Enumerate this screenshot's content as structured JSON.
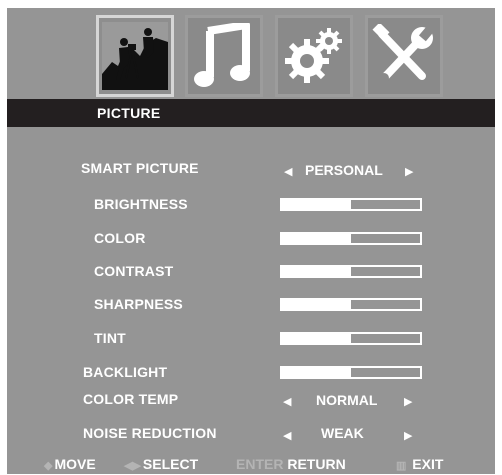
{
  "menu": {
    "tabs": [
      {
        "name": "picture",
        "icon": "photographer-icon",
        "active": true
      },
      {
        "name": "audio",
        "icon": "music-note-icon",
        "active": false
      },
      {
        "name": "settings",
        "icon": "gears-icon",
        "active": false
      },
      {
        "name": "tools",
        "icon": "wrench-screwdriver-icon",
        "active": false
      }
    ],
    "title": "PICTURE"
  },
  "settings": {
    "smart_picture": {
      "label": "SMART PICTURE",
      "value": "PERSONAL"
    },
    "brightness": {
      "label": "BRIGHTNESS",
      "level": 0.5
    },
    "color": {
      "label": "COLOR",
      "level": 0.5
    },
    "contrast": {
      "label": "CONTRAST",
      "level": 0.5
    },
    "sharpness": {
      "label": "SHARPNESS",
      "level": 0.5
    },
    "tint": {
      "label": "TINT",
      "level": 0.5
    },
    "backlight": {
      "label": "BACKLIGHT",
      "level": 0.5
    },
    "color_temp": {
      "label": "COLOR TEMP",
      "value": "NORMAL"
    },
    "noise_reduction": {
      "label": "NOISE REDUCTION",
      "value": "WEAK"
    }
  },
  "footer": {
    "move": {
      "glyph": "◆",
      "label": "MOVE"
    },
    "select": {
      "glyph": "◀▶",
      "label": "SELECT"
    },
    "enter": {
      "key": "ENTER",
      "label": "RETURN"
    },
    "exit": {
      "glyph": "▥",
      "label": "EXIT"
    }
  },
  "arrows": {
    "left": "◀",
    "right": "▶"
  },
  "colors": {
    "background": "#959595",
    "title_bar": "#231f20",
    "text": "#ffffff",
    "dim_text": "#b4b4b4"
  }
}
